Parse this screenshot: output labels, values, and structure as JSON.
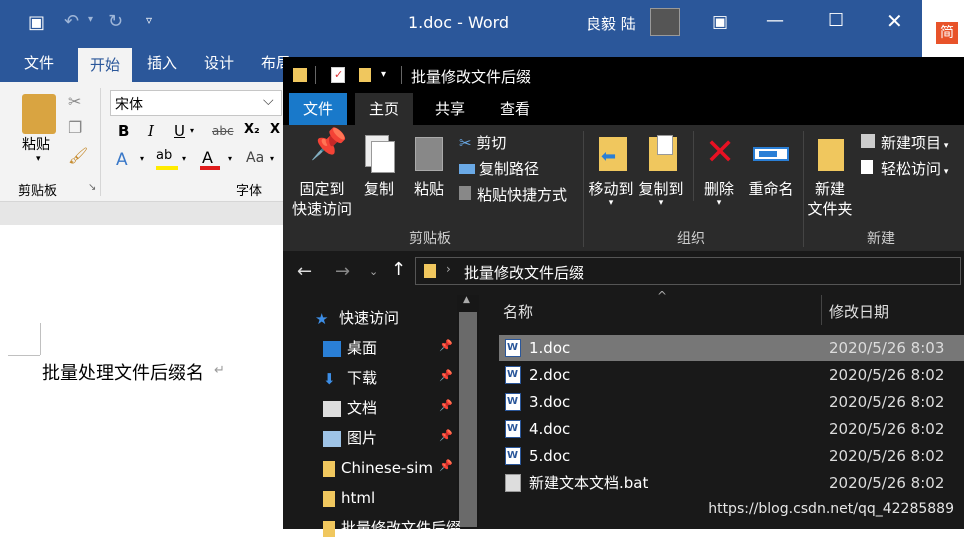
{
  "word": {
    "title": "1.doc  -  Word",
    "user": "良毅 陆",
    "tabs": [
      "文件",
      "开始",
      "插入",
      "设计",
      "布局"
    ],
    "ribbon": {
      "font_name": "宋体",
      "paste_label": "粘贴",
      "clipboard_group": "剪贴板",
      "font_group": "字体",
      "bold": "B",
      "italic": "I",
      "underline": "U",
      "strike": "abc",
      "subscript": "X₂",
      "x_label": "X",
      "aa_label": "Aa"
    },
    "doc_text": "批量处理文件后缀名",
    "right_badge": "简"
  },
  "explorer": {
    "title": "批量修改文件后缀",
    "tabs": [
      "文件",
      "主页",
      "共享",
      "查看"
    ],
    "ribbon": {
      "pin_label": "固定到\n快速访问",
      "pin_line1": "固定到",
      "pin_line2": "快速访问",
      "copy": "复制",
      "paste": "粘贴",
      "cut": "剪切",
      "copy_path": "复制路径",
      "paste_shortcut": "粘贴快捷方式",
      "move_to": "移动到",
      "copy_to": "复制到",
      "delete": "删除",
      "rename": "重命名",
      "new_folder_l1": "新建",
      "new_folder_l2": "文件夹",
      "new_item": "新建项目",
      "easy_access": "轻松访问",
      "group_clipboard": "剪贴板",
      "group_organize": "组织",
      "group_new": "新建"
    },
    "address": "批量修改文件后缀",
    "nav": [
      {
        "label": "快速访问",
        "icon": "star-icon",
        "pinned": false
      },
      {
        "label": "桌面",
        "icon": "desktop-icon",
        "pinned": true
      },
      {
        "label": "下载",
        "icon": "download-icon",
        "pinned": true
      },
      {
        "label": "文档",
        "icon": "document-icon",
        "pinned": true
      },
      {
        "label": "图片",
        "icon": "picture-icon",
        "pinned": true
      },
      {
        "label": "Chinese-sim",
        "icon": "folder-icon",
        "pinned": true
      },
      {
        "label": "html",
        "icon": "folder-icon",
        "pinned": false
      },
      {
        "label": "批量修改文件后缀",
        "icon": "folder-icon",
        "pinned": false
      }
    ],
    "columns": {
      "name": "名称",
      "date": "修改日期"
    },
    "files": [
      {
        "name": "1.doc",
        "date": "2020/5/26 8:03",
        "type": "word"
      },
      {
        "name": "2.doc",
        "date": "2020/5/26 8:02",
        "type": "word"
      },
      {
        "name": "3.doc",
        "date": "2020/5/26 8:02",
        "type": "word"
      },
      {
        "name": "4.doc",
        "date": "2020/5/26 8:02",
        "type": "word"
      },
      {
        "name": "5.doc",
        "date": "2020/5/26 8:02",
        "type": "word"
      },
      {
        "name": "新建文本文档.bat",
        "date": "2020/5/26 8:02",
        "type": "bat"
      }
    ],
    "selected_index": 0,
    "watermark": "https://blog.csdn.net/qq_42285889"
  },
  "colors": {
    "word_blue": "#2b579a",
    "explorer_bg": "#191919",
    "selection": "#777777",
    "folder_yellow": "#f0c75e"
  }
}
